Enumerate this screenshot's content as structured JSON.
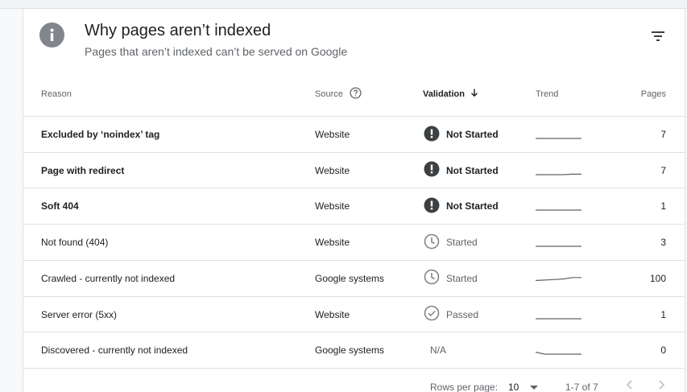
{
  "card": {
    "title": "Why pages aren’t indexed",
    "subtitle": "Pages that aren’t indexed can’t be served on Google",
    "icons": {
      "header": "info-icon",
      "filter": "filter-icon"
    }
  },
  "table": {
    "headers": {
      "reason": "Reason",
      "source": "Source",
      "validation": "Validation",
      "trend": "Trend",
      "pages": "Pages"
    },
    "rows": [
      {
        "reason": "Excluded by ‘noindex’ tag",
        "source": "Website",
        "validation": "Not Started",
        "validation_icon": "exclamation-icon",
        "trend": [
          0,
          0,
          0,
          0,
          0,
          0
        ],
        "pages": "7"
      },
      {
        "reason": "Page with redirect",
        "source": "Website",
        "validation": "Not Started",
        "validation_icon": "exclamation-icon",
        "trend": [
          0,
          0,
          0,
          0,
          0.5,
          0.5
        ],
        "pages": "7"
      },
      {
        "reason": "Soft 404",
        "source": "Website",
        "validation": "Not Started",
        "validation_icon": "exclamation-icon",
        "trend": [
          0,
          0,
          0,
          0,
          0,
          0
        ],
        "pages": "1"
      },
      {
        "reason": "Not found (404)",
        "source": "Website",
        "validation": "Started",
        "validation_icon": "clock-icon",
        "trend": [
          0,
          0,
          0,
          0,
          0,
          0
        ],
        "pages": "3"
      },
      {
        "reason": "Crawled - currently not indexed",
        "source": "Google systems",
        "validation": "Started",
        "validation_icon": "clock-icon",
        "trend": [
          2,
          2.5,
          3,
          3.5,
          5,
          5
        ],
        "pages": "100"
      },
      {
        "reason": "Server error (5xx)",
        "source": "Website",
        "validation": "Passed",
        "validation_icon": "check-circle-icon",
        "trend": [
          0,
          0,
          0,
          0,
          0,
          0
        ],
        "pages": "1"
      },
      {
        "reason": "Discovered - currently not indexed",
        "source": "Google systems",
        "validation": "N/A",
        "validation_icon": "",
        "trend": [
          2,
          0,
          0,
          0,
          0,
          0
        ],
        "pages": "0"
      }
    ]
  },
  "footer": {
    "rows_per_page_label": "Rows per page:",
    "rows_per_page": "10",
    "range": "1-7 of 7"
  },
  "colors": {
    "text": "#202124",
    "secondary": "#5f6368",
    "icon_dark": "#3c4043",
    "icon_grey": "#80868b",
    "divider": "#e0e0e0"
  }
}
